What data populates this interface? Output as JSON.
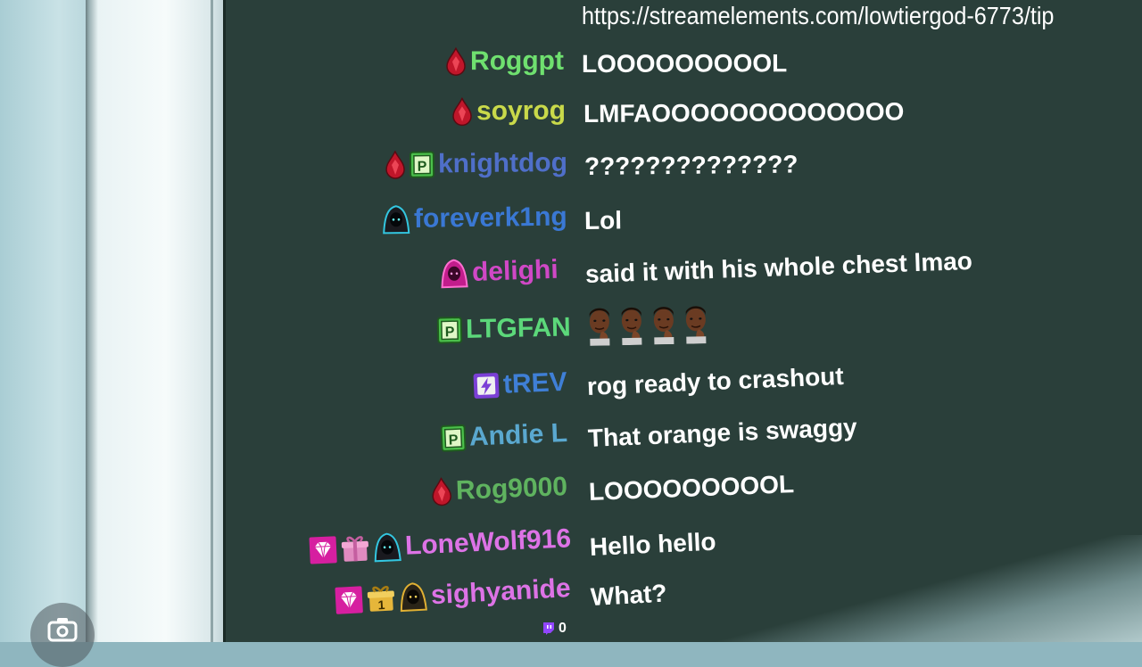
{
  "tip_url": "https://streamelements.com/lowtiergod-6773/tip",
  "chat": [
    {
      "username": "Roggpt",
      "color": "#6fe06f",
      "badges": [
        "ruby-icon"
      ],
      "message": "LOOOOOOOOOL"
    },
    {
      "username": "soyrog",
      "color": "#c9d94a",
      "badges": [
        "ruby-icon"
      ],
      "message": "LMFAOOOOOOOOOOOOO"
    },
    {
      "username": "knightdog",
      "color": "#4f6fc9",
      "badges": [
        "ruby-icon",
        "prime-p-icon"
      ],
      "message": "??????????????"
    },
    {
      "username": "foreverk1ng",
      "color": "#3a78d4",
      "badges": [
        "hooded-figure-blue-icon"
      ],
      "message": "Lol"
    },
    {
      "username": "delighi",
      "color": "#d048c6",
      "badges": [
        "hooded-figure-pink-icon"
      ],
      "message": "said it with his whole chest lmao"
    },
    {
      "username": "LTGFAN",
      "color": "#5cd87a",
      "badges": [
        "prime-p-icon"
      ],
      "message": "",
      "emote_count": 4
    },
    {
      "username": "tREV",
      "color": "#3f7fd6",
      "badges": [
        "lightning-icon"
      ],
      "message": "rog ready to crashout"
    },
    {
      "username": "Andie L",
      "color": "#5aa8cf",
      "badges": [
        "prime-p-icon"
      ],
      "message": "That orange is swaggy"
    },
    {
      "username": "Rog9000",
      "color": "#5fb35f",
      "badges": [
        "ruby-icon"
      ],
      "message": "LOOOOOOOOOL"
    },
    {
      "username": "LoneWolf916",
      "color": "#dd73e6",
      "badges": [
        "gem-icon",
        "gift-icon",
        "hooded-figure-blue-icon"
      ],
      "message": "Hello hello"
    },
    {
      "username": "sighyanide",
      "color": "#dd73e6",
      "badges": [
        "gem-icon",
        "gift-one-icon",
        "hooded-figure-gold-icon"
      ],
      "message": "What?"
    }
  ],
  "gift_badge_number": "1",
  "viewer_count": "0",
  "colors": {
    "screen_bg": "#2a3f3a",
    "message_text": "#ffffff"
  }
}
